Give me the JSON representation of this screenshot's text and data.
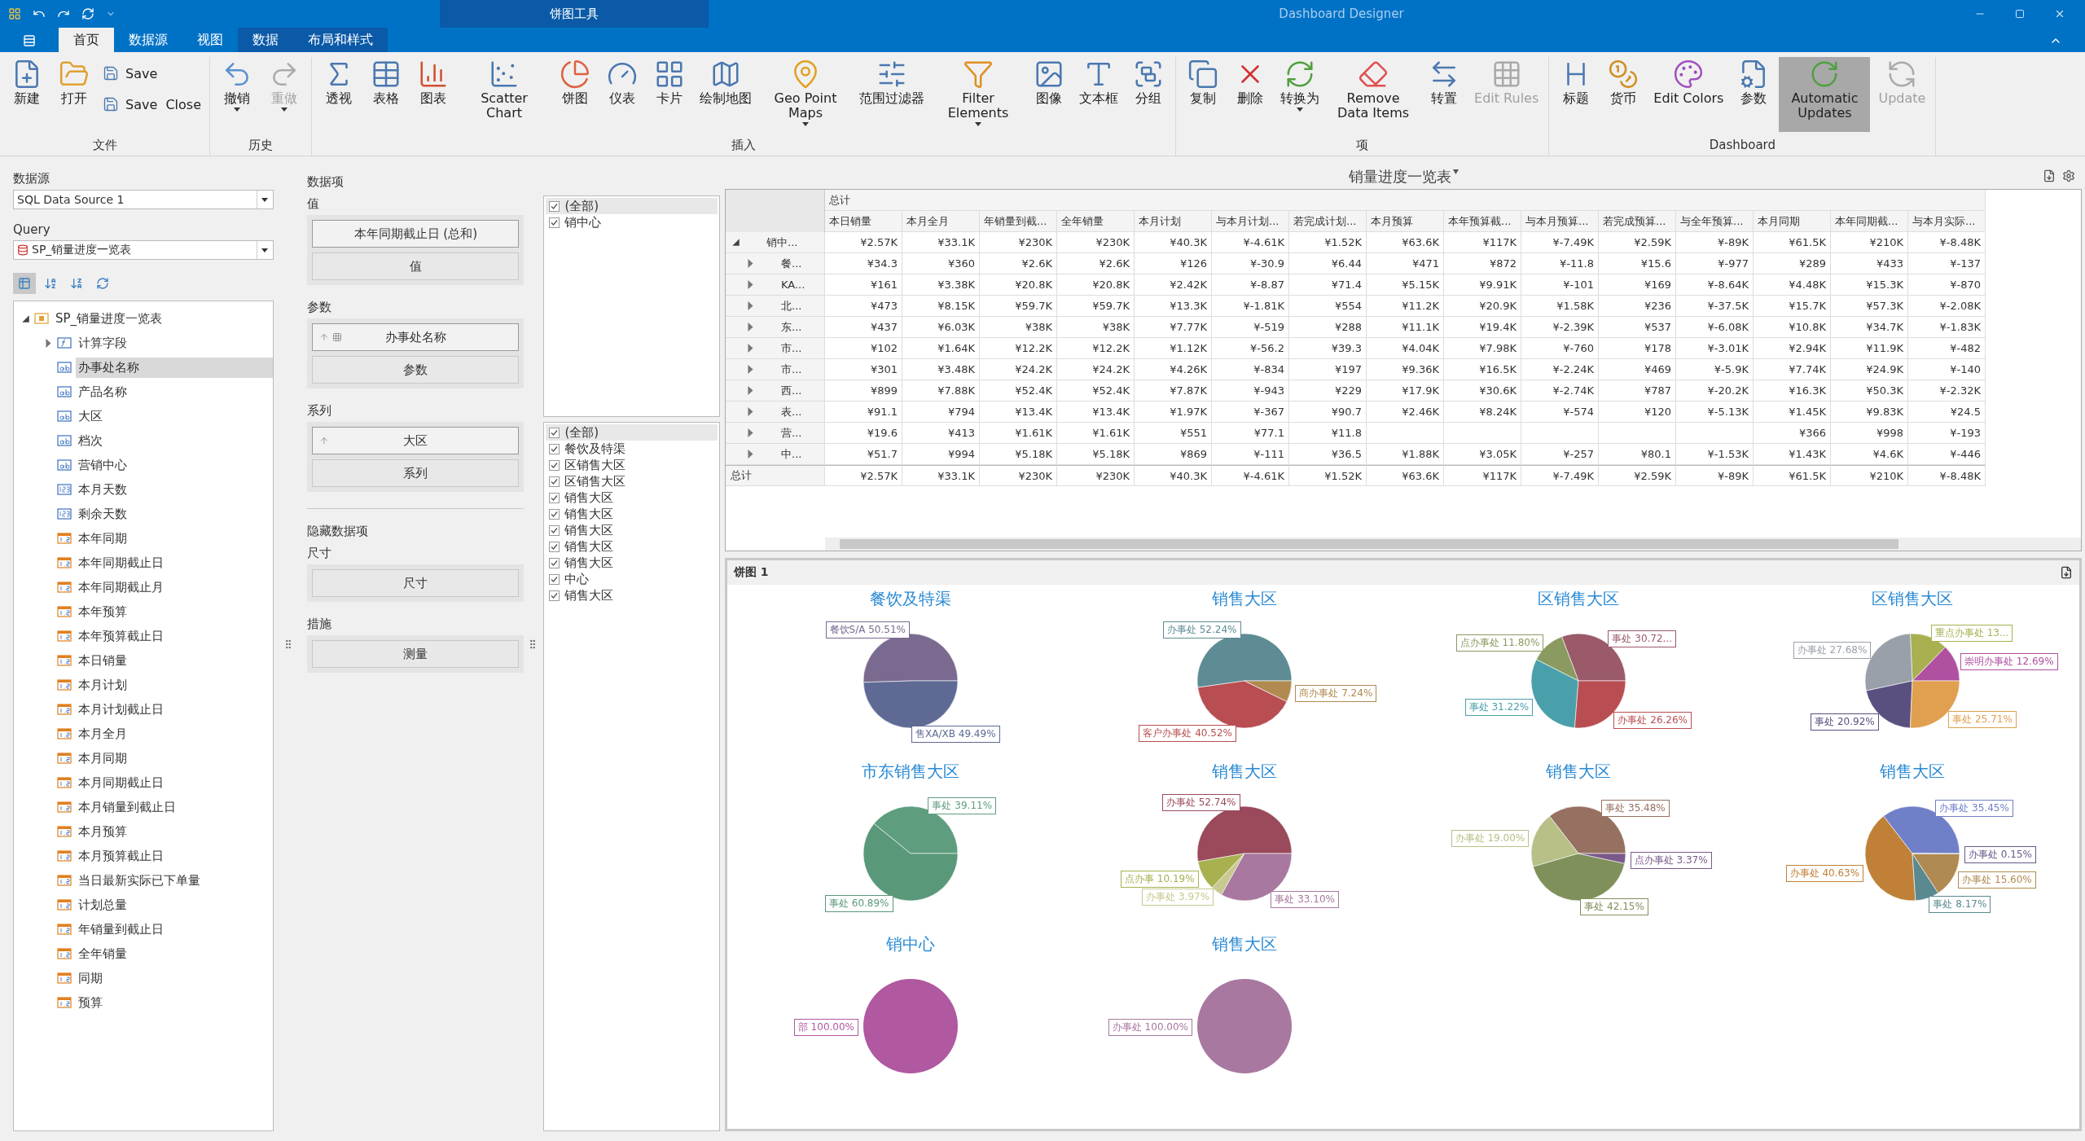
{
  "window": {
    "title": "Dashboard Designer",
    "context_tab_group": "饼图工具"
  },
  "tabs": [
    {
      "label": "首页",
      "selected": true,
      "kind": "main"
    },
    {
      "label": "数据源",
      "selected": false,
      "kind": "main"
    },
    {
      "label": "视图",
      "selected": false,
      "kind": "main"
    },
    {
      "label": "数据",
      "selected": false,
      "kind": "context"
    },
    {
      "label": "布局和样式",
      "selected": false,
      "kind": "context"
    }
  ],
  "ribbon": [
    {
      "label": "文件",
      "buttons": [
        {
          "label": "新建",
          "kind": "large",
          "disabled": false,
          "pressed": false,
          "dropdown": false
        },
        {
          "label": "打开",
          "kind": "large",
          "disabled": false,
          "pressed": false,
          "dropdown": false
        },
        {
          "label": "Save",
          "kind": "small",
          "disabled": false,
          "pressed": false,
          "dropdown": false
        },
        {
          "label": "Save  Close",
          "kind": "small",
          "disabled": false,
          "pressed": false,
          "dropdown": false
        }
      ]
    },
    {
      "label": "历史",
      "buttons": [
        {
          "label": "撤销",
          "kind": "large",
          "disabled": false,
          "pressed": false,
          "dropdown": true
        },
        {
          "label": "重做",
          "kind": "large",
          "disabled": true,
          "pressed": false,
          "dropdown": true
        }
      ]
    },
    {
      "label": "插入",
      "buttons": [
        {
          "label": "透视",
          "kind": "large",
          "disabled": false,
          "pressed": false,
          "dropdown": false
        },
        {
          "label": "表格",
          "kind": "large",
          "disabled": false,
          "pressed": false,
          "dropdown": false
        },
        {
          "label": "图表",
          "kind": "large",
          "disabled": false,
          "pressed": false,
          "dropdown": false
        },
        {
          "label": "Scatter Chart",
          "kind": "large",
          "disabled": false,
          "pressed": false,
          "dropdown": false
        },
        {
          "label": "饼图",
          "kind": "large",
          "disabled": false,
          "pressed": false,
          "dropdown": false
        },
        {
          "label": "仪表",
          "kind": "large",
          "disabled": false,
          "pressed": false,
          "dropdown": false
        },
        {
          "label": "卡片",
          "kind": "large",
          "disabled": false,
          "pressed": false,
          "dropdown": false
        },
        {
          "label": "绘制地图",
          "kind": "large",
          "disabled": false,
          "pressed": false,
          "dropdown": false
        },
        {
          "label": "Geo Point Maps",
          "kind": "large",
          "disabled": false,
          "pressed": false,
          "dropdown": true
        },
        {
          "label": "范围过滤器",
          "kind": "large",
          "disabled": false,
          "pressed": false,
          "dropdown": false
        },
        {
          "label": "Filter Elements",
          "kind": "large",
          "disabled": false,
          "pressed": false,
          "dropdown": true
        },
        {
          "label": "图像",
          "kind": "large",
          "disabled": false,
          "pressed": false,
          "dropdown": false
        },
        {
          "label": "文本框",
          "kind": "large",
          "disabled": false,
          "pressed": false,
          "dropdown": false
        },
        {
          "label": "分组",
          "kind": "large",
          "disabled": false,
          "pressed": false,
          "dropdown": false
        }
      ]
    },
    {
      "label": "项",
      "buttons": [
        {
          "label": "复制",
          "kind": "large",
          "disabled": false,
          "pressed": false,
          "dropdown": false
        },
        {
          "label": "删除",
          "kind": "large",
          "disabled": false,
          "pressed": false,
          "dropdown": false
        },
        {
          "label": "转换为",
          "kind": "large",
          "disabled": false,
          "pressed": false,
          "dropdown": true
        },
        {
          "label": "Remove Data Items",
          "kind": "large",
          "disabled": false,
          "pressed": false,
          "dropdown": false
        },
        {
          "label": "转置",
          "kind": "large",
          "disabled": false,
          "pressed": false,
          "dropdown": false
        },
        {
          "label": "Edit Rules",
          "kind": "large",
          "disabled": true,
          "pressed": false,
          "dropdown": false
        }
      ]
    },
    {
      "label": "Dashboard",
      "buttons": [
        {
          "label": "标题",
          "kind": "large",
          "disabled": false,
          "pressed": false,
          "dropdown": false
        },
        {
          "label": "货币",
          "kind": "large",
          "disabled": false,
          "pressed": false,
          "dropdown": false
        },
        {
          "label": "Edit Colors",
          "kind": "large",
          "disabled": false,
          "pressed": false,
          "dropdown": false
        },
        {
          "label": "参数",
          "kind": "large",
          "disabled": false,
          "pressed": false,
          "dropdown": false
        },
        {
          "label": "Automatic Updates",
          "kind": "large",
          "disabled": false,
          "pressed": true,
          "dropdown": false
        },
        {
          "label": "Update",
          "kind": "large",
          "disabled": true,
          "pressed": false,
          "dropdown": false
        }
      ]
    }
  ],
  "data_source": {
    "label": "数据源",
    "value": "SQL Data Source 1",
    "query_label": "Query",
    "query_value": "SP_销量进度一览表"
  },
  "field_toolbar": [
    {
      "pressed": true
    },
    {
      "pressed": false
    },
    {
      "pressed": false
    },
    {
      "pressed": false
    }
  ],
  "field_tree": [
    {
      "label": "SP_销量进度一览表",
      "kind": "table",
      "expanded": true,
      "selected": false,
      "children": [
        {
          "label": "计算字段",
          "kind": "calc",
          "expanded": false,
          "selected": false
        },
        {
          "label": "办事处名称",
          "kind": "text",
          "selected": true
        },
        {
          "label": "产品名称",
          "kind": "text",
          "selected": false
        },
        {
          "label": "大区",
          "kind": "text",
          "selected": false
        },
        {
          "label": "档次",
          "kind": "text",
          "selected": false
        },
        {
          "label": "营销中心",
          "kind": "text",
          "selected": false
        },
        {
          "label": "本月天数",
          "kind": "integer",
          "selected": false
        },
        {
          "label": "剩余天数",
          "kind": "integer",
          "selected": false
        },
        {
          "label": "本年同期",
          "kind": "decimal",
          "selected": false
        },
        {
          "label": "本年同期截止日",
          "kind": "decimal",
          "selected": false
        },
        {
          "label": "本年同期截止月",
          "kind": "decimal",
          "selected": false
        },
        {
          "label": "本年预算",
          "kind": "decimal",
          "selected": false
        },
        {
          "label": "本年预算截止日",
          "kind": "decimal",
          "selected": false
        },
        {
          "label": "本日销量",
          "kind": "decimal",
          "selected": false
        },
        {
          "label": "本月计划",
          "kind": "decimal",
          "selected": false
        },
        {
          "label": "本月计划截止日",
          "kind": "decimal",
          "selected": false
        },
        {
          "label": "本月全月",
          "kind": "decimal",
          "selected": false
        },
        {
          "label": "本月同期",
          "kind": "decimal",
          "selected": false
        },
        {
          "label": "本月同期截止日",
          "kind": "decimal",
          "selected": false
        },
        {
          "label": "本月销量到截止日",
          "kind": "decimal",
          "selected": false
        },
        {
          "label": "本月预算",
          "kind": "decimal",
          "selected": false
        },
        {
          "label": "本月预算截止日",
          "kind": "decimal",
          "selected": false
        },
        {
          "label": "当日最新实际已下单量",
          "kind": "decimal",
          "selected": false
        },
        {
          "label": "计划总量",
          "kind": "decimal",
          "selected": false
        },
        {
          "label": "年销量到截止日",
          "kind": "decimal",
          "selected": false
        },
        {
          "label": "全年销量",
          "kind": "decimal",
          "selected": false
        },
        {
          "label": "同期",
          "kind": "decimal",
          "selected": false
        },
        {
          "label": "预算",
          "kind": "decimal",
          "selected": false
        }
      ]
    }
  ],
  "data_items": {
    "title": "数据项",
    "sections": [
      {
        "label": "值",
        "slots": [
          {
            "label": "本年同期截止日 (总和)",
            "kind": "item"
          },
          {
            "label": "值",
            "kind": "drop"
          }
        ]
      },
      {
        "label": "参数",
        "slots": [
          {
            "label": "办事处名称",
            "kind": "dimension"
          },
          {
            "label": "参数",
            "kind": "drop"
          }
        ]
      },
      {
        "label": "系列",
        "slots": [
          {
            "label": "大区",
            "kind": "sort"
          },
          {
            "label": "系列",
            "kind": "drop"
          }
        ]
      }
    ],
    "hidden_title": "隐藏数据项",
    "hidden_sections": [
      {
        "label": "尺寸",
        "slots": [
          {
            "label": "尺寸",
            "kind": "drop"
          }
        ]
      },
      {
        "label": "措施",
        "slots": [
          {
            "label": "测量",
            "kind": "drop"
          }
        ]
      }
    ]
  },
  "filter_lists": [
    [
      {
        "label": "(全部)",
        "checked": true,
        "selected": true
      },
      {
        "label": "销中心",
        "checked": true,
        "selected": false
      }
    ],
    [
      {
        "label": "(全部)",
        "checked": true,
        "selected": true
      },
      {
        "label": "餐饮及特渠",
        "checked": true,
        "selected": false
      },
      {
        "label": "区销售大区",
        "checked": true,
        "selected": false
      },
      {
        "label": "区销售大区",
        "checked": true,
        "selected": false
      },
      {
        "label": "销售大区",
        "checked": true,
        "selected": false
      },
      {
        "label": "销售大区",
        "checked": true,
        "selected": false
      },
      {
        "label": "销售大区",
        "checked": true,
        "selected": false
      },
      {
        "label": "销售大区",
        "checked": true,
        "selected": false
      },
      {
        "label": "销售大区",
        "checked": true,
        "selected": false
      },
      {
        "label": "中心",
        "checked": true,
        "selected": false
      },
      {
        "label": "销售大区",
        "checked": true,
        "selected": false
      }
    ]
  ],
  "pivot": {
    "title": "销量进度一览表",
    "column_group": "总计",
    "columns": [
      "本日销量",
      "本月全月",
      "年销量到截...",
      "全年销量",
      "本月计划",
      "与本月计划...",
      "若完成计划...",
      "本月预算",
      "本年预算截...",
      "与本月预算...",
      "若完成预算...",
      "与全年预算...",
      "本月同期",
      "本年同期截...",
      "与本月实际..."
    ],
    "rows": [
      {
        "header": "销中...",
        "expanded": true,
        "cells": [
          "¥2.57K",
          "¥33.1K",
          "¥230K",
          "¥230K",
          "¥40.3K",
          "¥-4.61K",
          "¥1.52K",
          "¥63.6K",
          "¥117K",
          "¥-7.49K",
          "¥2.59K",
          "¥-89K",
          "¥61.5K",
          "¥210K",
          "¥-8.48K"
        ],
        "children": [
          {
            "header": "餐...",
            "expanded": false,
            "cells": [
              "¥34.3",
              "¥360",
              "¥2.6K",
              "¥2.6K",
              "¥126",
              "¥-30.9",
              "¥6.44",
              "¥471",
              "¥872",
              "¥-11.8",
              "¥15.6",
              "¥-977",
              "¥289",
              "¥433",
              "¥-137"
            ]
          },
          {
            "header": "KA...",
            "expanded": false,
            "cells": [
              "¥161",
              "¥3.38K",
              "¥20.8K",
              "¥20.8K",
              "¥2.42K",
              "¥-8.87",
              "¥71.4",
              "¥5.15K",
              "¥9.91K",
              "¥-101",
              "¥169",
              "¥-8.64K",
              "¥4.48K",
              "¥15.3K",
              "¥-870"
            ]
          },
          {
            "header": "北...",
            "expanded": false,
            "cells": [
              "¥473",
              "¥8.15K",
              "¥59.7K",
              "¥59.7K",
              "¥13.3K",
              "¥-1.81K",
              "¥554",
              "¥11.2K",
              "¥20.9K",
              "¥1.58K",
              "¥236",
              "¥-37.5K",
              "¥15.7K",
              "¥57.3K",
              "¥-2.08K"
            ]
          },
          {
            "header": "东...",
            "expanded": false,
            "cells": [
              "¥437",
              "¥6.03K",
              "¥38K",
              "¥38K",
              "¥7.77K",
              "¥-519",
              "¥288",
              "¥11.1K",
              "¥19.4K",
              "¥-2.39K",
              "¥537",
              "¥-6.08K",
              "¥10.8K",
              "¥34.7K",
              "¥-1.83K"
            ]
          },
          {
            "header": "市...",
            "expanded": false,
            "cells": [
              "¥102",
              "¥1.64K",
              "¥12.2K",
              "¥12.2K",
              "¥1.12K",
              "¥-56.2",
              "¥39.3",
              "¥4.04K",
              "¥7.98K",
              "¥-760",
              "¥178",
              "¥-3.01K",
              "¥2.94K",
              "¥11.9K",
              "¥-482"
            ]
          },
          {
            "header": "市...",
            "expanded": false,
            "cells": [
              "¥301",
              "¥3.48K",
              "¥24.2K",
              "¥24.2K",
              "¥4.26K",
              "¥-834",
              "¥197",
              "¥9.36K",
              "¥16.5K",
              "¥-2.24K",
              "¥469",
              "¥-5.9K",
              "¥7.74K",
              "¥24.9K",
              "¥-140"
            ]
          },
          {
            "header": "西...",
            "expanded": false,
            "cells": [
              "¥899",
              "¥7.88K",
              "¥52.4K",
              "¥52.4K",
              "¥7.87K",
              "¥-943",
              "¥229",
              "¥17.9K",
              "¥30.6K",
              "¥-2.74K",
              "¥787",
              "¥-20.2K",
              "¥16.3K",
              "¥50.3K",
              "¥-2.32K"
            ]
          },
          {
            "header": "表...",
            "expanded": false,
            "cells": [
              "¥91.1",
              "¥794",
              "¥13.4K",
              "¥13.4K",
              "¥1.97K",
              "¥-367",
              "¥90.7",
              "¥2.46K",
              "¥8.24K",
              "¥-574",
              "¥120",
              "¥-5.13K",
              "¥1.45K",
              "¥9.83K",
              "¥24.5"
            ]
          },
          {
            "header": "营...",
            "expanded": false,
            "cells": [
              "¥19.6",
              "¥413",
              "¥1.61K",
              "¥1.61K",
              "¥551",
              "¥77.1",
              "¥11.8",
              null,
              null,
              null,
              null,
              null,
              "¥366",
              "¥998",
              "¥-193"
            ]
          },
          {
            "header": "中...",
            "expanded": false,
            "cells": [
              "¥51.7",
              "¥994",
              "¥5.18K",
              "¥5.18K",
              "¥869",
              "¥-111",
              "¥36.5",
              "¥1.88K",
              "¥3.05K",
              "¥-257",
              "¥80.1",
              "¥-1.53K",
              "¥1.43K",
              "¥4.6K",
              "¥-446"
            ]
          }
        ]
      },
      {
        "header": "总计",
        "kind": "total",
        "cells": [
          "¥2.57K",
          "¥33.1K",
          "¥230K",
          "¥230K",
          "¥40.3K",
          "¥-4.61K",
          "¥1.52K",
          "¥63.6K",
          "¥117K",
          "¥-7.49K",
          "¥2.59K",
          "¥-89K",
          "¥61.5K",
          "¥210K",
          "¥-8.48K"
        ]
      }
    ]
  },
  "pie_panel": {
    "title": "饼图 1",
    "pies": [
      {
        "chart_data": {
          "type": "pie",
          "title": "餐饮及特渠",
          "categories": [
            "餐饮S/A",
            "售XA/XB"
          ],
          "values": [
            50.51,
            49.49
          ],
          "value_labels": [
            "50.51%",
            "49.49%"
          ],
          "colors": [
            "#7b6a8f",
            "#5e6a94"
          ]
        }
      },
      {
        "chart_data": {
          "type": "pie",
          "title": "销售大区",
          "categories": [
            "办事处",
            "客户办事处",
            "商办事处"
          ],
          "values": [
            52.24,
            40.52,
            7.24
          ],
          "value_labels": [
            "52.24%",
            "40.52%",
            "7.24%"
          ],
          "colors": [
            "#5e8c94",
            "#b94e52",
            "#b08a50"
          ]
        }
      },
      {
        "chart_data": {
          "type": "pie",
          "title": "区销售大区",
          "categories": [
            "事处",
            "点办事处",
            "事处",
            "办事处"
          ],
          "values": [
            30.72,
            11.8,
            31.22,
            26.26
          ],
          "value_labels": [
            "30.72...",
            "11.80%",
            "31.22%",
            "26.26%"
          ],
          "colors": [
            "#9a5a6a",
            "#8a9a60",
            "#4aa0aa",
            "#b94e52"
          ]
        }
      },
      {
        "chart_data": {
          "type": "pie",
          "title": "区销售大区",
          "categories": [
            "崇明办事处",
            "重点办事处",
            "办事处",
            "事处",
            "事处"
          ],
          "values": [
            12.69,
            13.0,
            27.68,
            20.92,
            25.71
          ],
          "value_labels": [
            "12.69%",
            "13...",
            "27.68%",
            "20.92%",
            "25.71%"
          ],
          "colors": [
            "#b050a0",
            "#a8b050",
            "#9aa0aa",
            "#5a5080",
            "#e0a050"
          ]
        }
      },
      {
        "chart_data": {
          "type": "pie",
          "title": "市东销售大区",
          "categories": [
            "事处",
            "事处"
          ],
          "values": [
            39.11,
            60.89
          ],
          "value_labels": [
            "39.11%",
            "60.89%"
          ],
          "colors": [
            "#5e9e7e",
            "#5a987a"
          ]
        }
      },
      {
        "chart_data": {
          "type": "pie",
          "title": "销售大区",
          "categories": [
            "办事处",
            "点办事",
            "办事处",
            "事处"
          ],
          "values": [
            52.74,
            10.19,
            3.97,
            33.1
          ],
          "value_labels": [
            "52.74%",
            "10.19%",
            "3.97%",
            "33.10%"
          ],
          "colors": [
            "#9a4a5a",
            "#a8b050",
            "#c8c890",
            "#a878a0"
          ]
        }
      },
      {
        "chart_data": {
          "type": "pie",
          "title": "销售大区",
          "categories": [
            "事处",
            "办事处",
            "事处",
            "点办事处"
          ],
          "values": [
            35.48,
            19.0,
            42.15,
            3.37
          ],
          "value_labels": [
            "35.48%",
            "19.00%",
            "42.15%",
            "3.37%"
          ],
          "colors": [
            "#967060",
            "#b8c088",
            "#80905a",
            "#7a5a8a"
          ]
        }
      },
      {
        "chart_data": {
          "type": "pie",
          "title": "销售大区",
          "categories": [
            "办事处",
            "办事处",
            "事处",
            "办事处",
            "办事处"
          ],
          "values": [
            35.45,
            40.63,
            8.17,
            15.6,
            0.15
          ],
          "value_labels": [
            "35.45%",
            "40.63%",
            "8.17%",
            "15.60%",
            "0.15%"
          ],
          "colors": [
            "#7080c8",
            "#c08038",
            "#5a8a90",
            "#b08a50",
            "#6a5a8a"
          ]
        }
      },
      {
        "chart_data": {
          "type": "pie",
          "title": "销中心",
          "categories": [
            "部"
          ],
          "values": [
            100
          ],
          "value_labels": [
            "100.00%"
          ],
          "colors": [
            "#b058a0"
          ]
        }
      },
      {
        "chart_data": {
          "type": "pie",
          "title": "销售大区",
          "categories": [
            "办事处"
          ],
          "values": [
            100
          ],
          "value_labels": [
            "100.00%"
          ],
          "colors": [
            "#a878a0"
          ]
        }
      }
    ]
  }
}
